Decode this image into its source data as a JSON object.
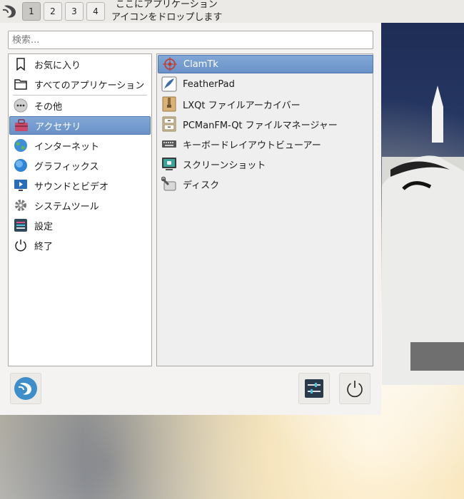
{
  "panel": {
    "desktops": [
      "1",
      "2",
      "3",
      "4"
    ],
    "active_desktop": "1",
    "hint_line1": "ここにアプリケーション",
    "hint_line2": "アイコンをドロップします"
  },
  "search": {
    "placeholder": "検索...",
    "value": ""
  },
  "categories": [
    {
      "label": "お気に入り",
      "icon": "bookmark-icon"
    },
    {
      "label": "すべてのアプリケーション",
      "icon": "folder-icon"
    },
    {
      "label": "その他",
      "icon": "more-icon"
    },
    {
      "label": "アクセサリ",
      "icon": "toolbox-icon",
      "selected": true
    },
    {
      "label": "インターネット",
      "icon": "globe-icon"
    },
    {
      "label": "グラフィックス",
      "icon": "graphics-icon"
    },
    {
      "label": "サウンドとビデオ",
      "icon": "multimedia-icon"
    },
    {
      "label": "システムツール",
      "icon": "gear-icon"
    },
    {
      "label": "設定",
      "icon": "settings-icon"
    },
    {
      "label": "終了",
      "icon": "power-icon"
    }
  ],
  "apps": [
    {
      "label": "ClamTk",
      "icon": "clamtk-icon",
      "selected": true
    },
    {
      "label": "FeatherPad",
      "icon": "featherpad-icon"
    },
    {
      "label": "LXQt ファイルアーカイバー",
      "icon": "archive-icon"
    },
    {
      "label": "PCManFM-Qt ファイルマネージャー",
      "icon": "file-cabinet-icon"
    },
    {
      "label": "キーボードレイアウトビューアー",
      "icon": "keyboard-icon"
    },
    {
      "label": "スクリーンショット",
      "icon": "screenshot-icon"
    },
    {
      "label": "ディスク",
      "icon": "disk-tools-icon"
    }
  ],
  "colors": {
    "selection": "#6a92c8",
    "panel_bg": "#eceae7",
    "menu_bg": "#f4f3f1"
  }
}
